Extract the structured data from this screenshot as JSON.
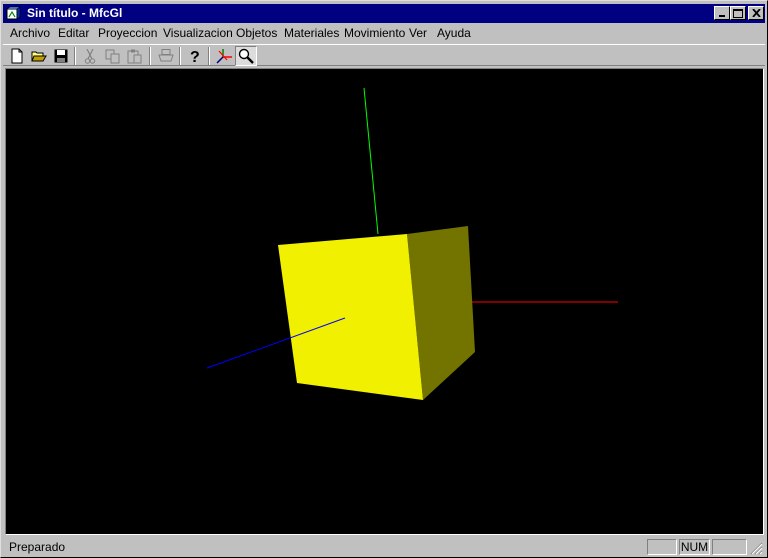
{
  "window": {
    "title": "Sin título - MfcGl"
  },
  "menu": [
    "Archivo",
    "Editar",
    "Proyeccion",
    "Visualizacion",
    "Objetos",
    "Materiales",
    "Movimiento",
    "Ver",
    "Ayuda"
  ],
  "toolbar": {
    "buttons": [
      "new-file",
      "open-folder",
      "save",
      "cut",
      "copy",
      "paste",
      "print",
      "help",
      "axes",
      "zoom"
    ],
    "pressed": "zoom"
  },
  "scene": {
    "background": "#000000",
    "cube_front_color": "#f0f000",
    "cube_side_color": "#737300",
    "axis_colors": {
      "x": "#ff0000",
      "y": "#00ff00",
      "z": "#0000ff"
    }
  },
  "status": {
    "text": "Preparado",
    "indicators": [
      "",
      "NUM",
      ""
    ]
  }
}
